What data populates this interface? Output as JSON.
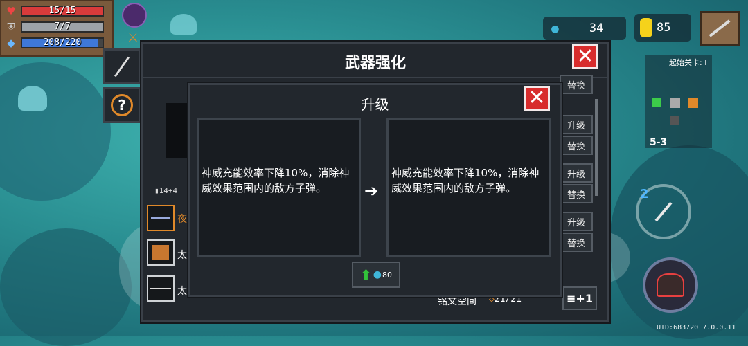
{
  "hud": {
    "hp": {
      "text": "15/15",
      "value": 15,
      "max": 15,
      "color": "#d93b3b"
    },
    "armor": {
      "text": "7/7",
      "value": 7,
      "max": 7,
      "color": "#9ea3a8"
    },
    "energy": {
      "text": "208/220",
      "value": 208,
      "max": 220,
      "color": "#3f78d8"
    },
    "gems": "34",
    "coins": "85"
  },
  "minimap": {
    "label": "起始关卡: I",
    "stage": "5-3"
  },
  "weapon_panel": {
    "title": "武器强化",
    "stat": "14+4",
    "weapons": [
      {
        "label": "夜",
        "icon": "spear-icon",
        "selected": true
      },
      {
        "label": "太",
        "icon": "hammer-icon",
        "selected": false
      },
      {
        "label": "太",
        "icon": "katana-icon",
        "selected": false
      }
    ],
    "side_buttons": [
      "替换",
      "升级",
      "替换",
      "升级",
      "替换",
      "升级",
      "替换"
    ],
    "inscription_label": "铭文空间",
    "inscription_value": "21/21",
    "add_button": "≡+1"
  },
  "upgrade_dialog": {
    "title": "升级",
    "before": "神威充能效率下降10%，消除神威效果范围内的敌方子弹。",
    "after": "神威充能效率下降10%，消除神威效果范围内的敌方子弹。",
    "cost": "80"
  },
  "skill_charge": "2",
  "footer": "UID:683720 7.0.0.11",
  "colors": {
    "panel": "#22272d",
    "close": "#d82c2c",
    "accent_orange": "#e0892a",
    "gem": "#3fb6d8",
    "coin": "#f5d21b",
    "arrow_green": "#32c23a"
  }
}
